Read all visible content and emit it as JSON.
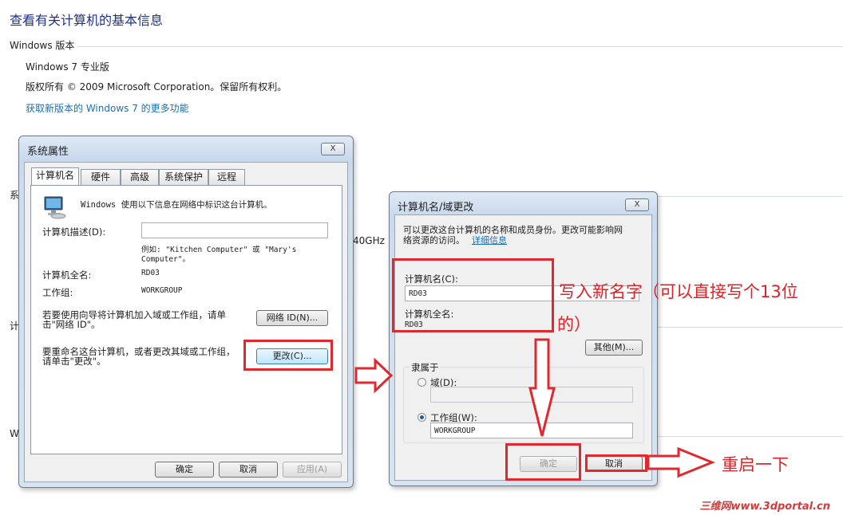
{
  "control_panel": {
    "title": "查看有关计算机的基本信息",
    "windows_edition_header": "Windows 版本",
    "edition": "Windows 7 专业版",
    "copyright": "版权所有 © 2009 Microsoft Corporation。保留所有权利。",
    "upgrade_link": "获取新版本的 Windows 7 的更多功能",
    "partial_section_1": "系",
    "partial_section_2": "计",
    "partial_section_3": "W",
    "partial_value": "40GHz"
  },
  "system_properties": {
    "title": "系统属性",
    "close_label": "X",
    "tabs": [
      "计算机名",
      "硬件",
      "高级",
      "系统保护",
      "远程"
    ],
    "intro": "Windows 使用以下信息在网络中标识这台计算机。",
    "description_label": "计算机描述(D):",
    "description_value": "",
    "example_line1": "例如: \"Kitchen Computer\" 或 \"Mary's",
    "example_line2": "Computer\"。",
    "full_name_label": "计算机全名:",
    "full_name_value": "RD03",
    "workgroup_label": "工作组:",
    "workgroup_value": "WORKGROUP",
    "network_text_line1": "若要使用向导将计算机加入域或工作组，请单",
    "network_text_line2": "击\"网络 ID\"。",
    "network_id_button": "网络 ID(N)...",
    "rename_text_line1": "要重命名这台计算机，或者更改其域或工作组，",
    "rename_text_line2": "请单击\"更改\"。",
    "change_button": "更改(C)...",
    "ok_button": "确定",
    "cancel_button": "取消",
    "apply_button": "应用(A)"
  },
  "name_change": {
    "title": "计算机名/域更改",
    "close_label": "X",
    "intro_line1": "可以更改这台计算机的名称和成员身份。更改可能影响网",
    "intro_line2": "络资源的访问。",
    "details_link": "详细信息",
    "computer_name_label": "计算机名(C):",
    "computer_name_value": "RD03",
    "full_name_label": "计算机全名:",
    "full_name_value": "RD03",
    "more_button": "其他(M)...",
    "member_of_label": "隶属于",
    "domain_label": "域(D):",
    "domain_value": "",
    "workgroup_label": "工作组(W):",
    "workgroup_value": "WORKGROUP",
    "ok_button": "确定",
    "cancel_button": "取消"
  },
  "annotations": {
    "write_new_name_line1": "写入新名字（可以直接写个13位",
    "write_new_name_line2": "的）",
    "restart": "重启一下",
    "color": "#e0282f"
  },
  "watermark": "三维网www.3dportal.cn"
}
